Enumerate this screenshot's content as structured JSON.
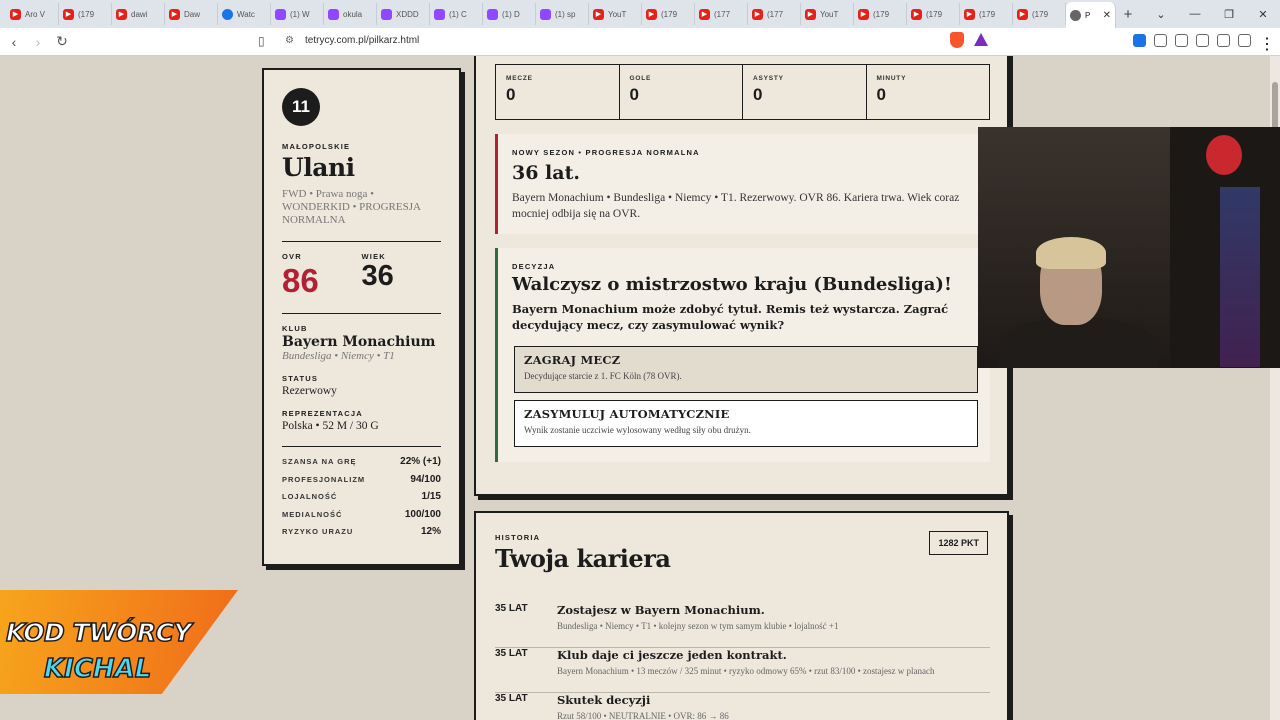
{
  "browser": {
    "tabs": [
      {
        "fav": "yt",
        "label": "Aro V"
      },
      {
        "fav": "yt",
        "label": "(179"
      },
      {
        "fav": "yt",
        "label": "dawi"
      },
      {
        "fav": "yt",
        "label": "Daw"
      },
      {
        "fav": "cr",
        "label": "Watc"
      },
      {
        "fav": "tw",
        "label": "(1) W"
      },
      {
        "fav": "tw",
        "label": "okula"
      },
      {
        "fav": "tw",
        "label": "XDDD"
      },
      {
        "fav": "tw",
        "label": "(1) C"
      },
      {
        "fav": "tw",
        "label": "(1) D"
      },
      {
        "fav": "tw",
        "label": "(1) sp"
      },
      {
        "fav": "yt",
        "label": "YouT"
      },
      {
        "fav": "yt",
        "label": "(179"
      },
      {
        "fav": "yt",
        "label": "(177"
      },
      {
        "fav": "yt",
        "label": "(177"
      },
      {
        "fav": "yt",
        "label": "YouT"
      },
      {
        "fav": "yt",
        "label": "(179"
      },
      {
        "fav": "yt",
        "label": "(179"
      },
      {
        "fav": "yt",
        "label": "(179"
      },
      {
        "fav": "yt",
        "label": "(179"
      }
    ],
    "active_tab": "P",
    "url": "tetrycy.com.pl/pilkarz.html"
  },
  "player": {
    "number": "11",
    "region": "MAŁOPOLSKIE",
    "name": "Ulani",
    "description": "FWD • Prawa noga • WONDERKID • PROGRESJA NORMALNA",
    "ovr_label": "OVR",
    "ovr": "86",
    "age_label": "WIEK",
    "age": "36",
    "club_label": "KLUB",
    "club": "Bayern Monachium",
    "club_sub": "Bundesliga • Niemcy • T1",
    "status_label": "STATUS",
    "status": "Rezerwowy",
    "national_label": "REPREZENTACJA",
    "national": "Polska • 52 M / 30 G",
    "attributes": [
      {
        "label": "SZANSA NA GRĘ",
        "value": "22% (+1)"
      },
      {
        "label": "PROFESJONALIZM",
        "value": "94/100"
      },
      {
        "label": "LOJALNOŚĆ",
        "value": "1/15"
      },
      {
        "label": "MEDIALNOŚĆ",
        "value": "100/100"
      },
      {
        "label": "RYZYKO URAZU",
        "value": "12%"
      }
    ]
  },
  "stats": [
    {
      "label": "MECZE",
      "value": "0"
    },
    {
      "label": "GOLE",
      "value": "0"
    },
    {
      "label": "ASYSTY",
      "value": "0"
    },
    {
      "label": "MINUTY",
      "value": "0"
    }
  ],
  "season": {
    "kicker": "NOWY SEZON • PROGRESJA NORMALNA",
    "heading": "36 lat.",
    "text": "Bayern Monachium • Bundesliga • Niemcy • T1. Rezerwowy. OVR 86. Kariera trwa. Wiek coraz mocniej odbija się na OVR."
  },
  "decision": {
    "kicker": "DECYZJA",
    "heading": "Walczysz o mistrzostwo kraju (Bundesliga)!",
    "text": "Bayern Monachium może zdobyć tytuł. Remis też wystarcza. Zagrać decydujący mecz, czy zasymulować wynik?",
    "option1_title": "ZAGRAJ MECZ",
    "option1_sub": "Decydujące starcie z 1. FC Köln (78 OVR).",
    "option2_title": "ZASYMULUJ AUTOMATYCZNIE",
    "option2_sub": "Wynik zostanie uczciwie wylosowany według siły obu drużyn."
  },
  "history": {
    "kicker": "HISTORIA",
    "title": "Twoja kariera",
    "points": "1282 PKT",
    "items": [
      {
        "age": "35 LAT",
        "title": "Zostajesz w Bayern Monachium.",
        "sub": "Bundesliga • Niemcy • T1 • kolejny sezon w tym samym klubie • lojalność +1"
      },
      {
        "age": "35 LAT",
        "title": "Klub daje ci jeszcze jeden kontrakt.",
        "sub": "Bayern Monachium • 13 meczów / 325 minut • ryzyko odmowy 65% • rzut 83/100 • zostajesz w planach"
      },
      {
        "age": "35 LAT",
        "title": "Skutek decyzji",
        "sub": "Rzut 58/100 • NEUTRALNIE • OVR: 86 → 86"
      }
    ]
  },
  "overlay": {
    "line1": "KOD TWÓRCY",
    "line2": "KICHAL"
  },
  "colors": {
    "accent_red": "#b22034",
    "accent_green": "#2f6b3c",
    "paper": "#ede7dc",
    "ink": "#1c1c1c"
  }
}
